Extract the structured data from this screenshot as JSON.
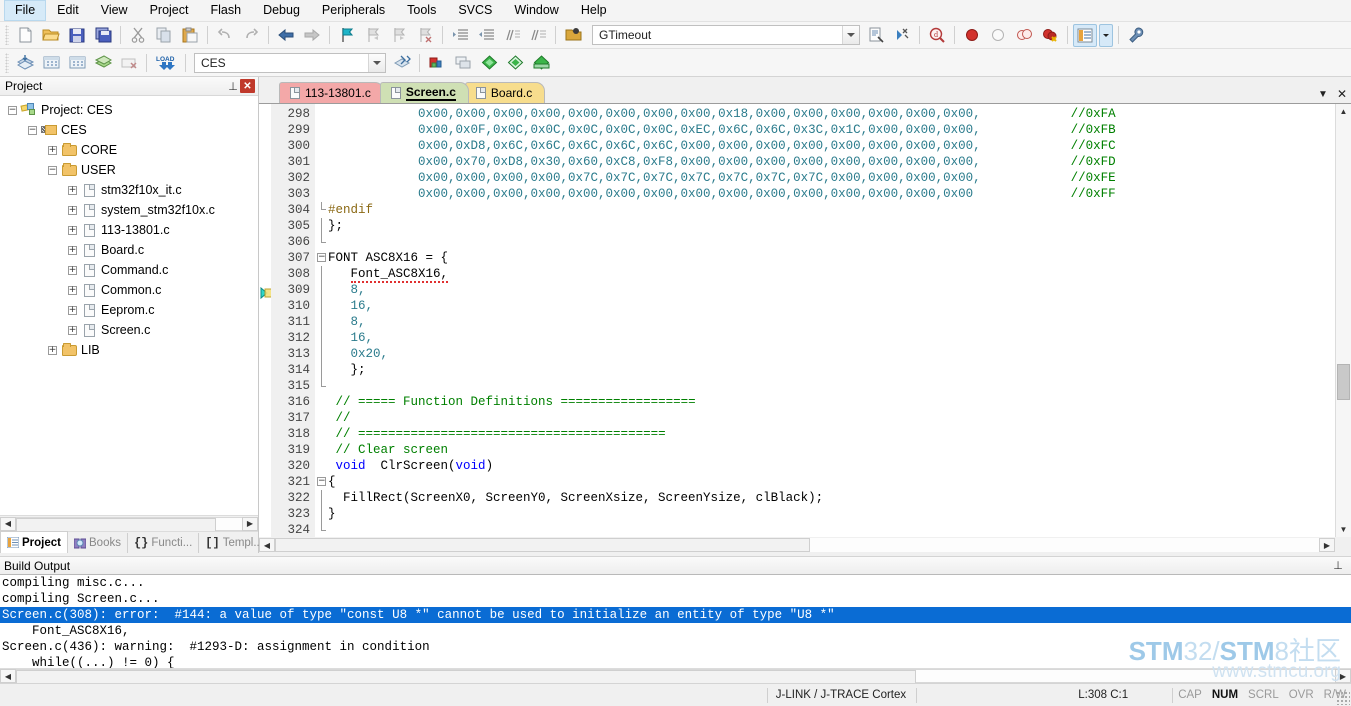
{
  "app": {
    "title": "uVision"
  },
  "menubar": {
    "items": [
      "File",
      "Edit",
      "View",
      "Project",
      "Flash",
      "Debug",
      "Peripherals",
      "Tools",
      "SVCS",
      "Window",
      "Help"
    ]
  },
  "toolbar1": {
    "buttons": [
      {
        "name": "new-file-icon",
        "label": "New"
      },
      {
        "name": "open-file-icon",
        "label": "Open"
      },
      {
        "name": "save-icon",
        "label": "Save"
      },
      {
        "name": "save-all-icon",
        "label": "Save All"
      },
      {
        "name": "cut-icon",
        "label": "Cut"
      },
      {
        "name": "copy-icon",
        "label": "Copy"
      },
      {
        "name": "paste-icon",
        "label": "Paste"
      },
      {
        "name": "undo-icon",
        "label": "Undo"
      },
      {
        "name": "redo-icon",
        "label": "Redo"
      },
      {
        "name": "navigate-back-icon",
        "label": "Back"
      },
      {
        "name": "navigate-forward-icon",
        "label": "Forward"
      },
      {
        "name": "bookmark-toggle-icon",
        "label": "Insert/Remove Bookmark"
      },
      {
        "name": "bookmark-prev-icon",
        "label": "Previous Bookmark"
      },
      {
        "name": "bookmark-next-icon",
        "label": "Next Bookmark"
      },
      {
        "name": "bookmark-clear-icon",
        "label": "Clear All Bookmarks"
      },
      {
        "name": "indent-icon",
        "label": "Indent Selected Text"
      },
      {
        "name": "outdent-icon",
        "label": "Outdent Selected Text"
      },
      {
        "name": "comment-icon",
        "label": "Comment Selection"
      },
      {
        "name": "uncomment-icon",
        "label": "Uncomment Selection"
      }
    ],
    "project_combo_value": "GTimeout",
    "project_combo_placeholder": "",
    "right_buttons": [
      {
        "name": "find-in-files-icon",
        "label": "Find in Files"
      },
      {
        "name": "incremental-find-icon",
        "label": "Incremental Find"
      },
      {
        "name": "find-all-icon",
        "label": "Find"
      },
      {
        "name": "breakpoint-icon",
        "label": "Insert/Remove Breakpoint"
      },
      {
        "name": "breakpoint-disable-icon",
        "label": "Enable/Disable Breakpoint"
      },
      {
        "name": "breakpoint-disable-all-icon",
        "label": "Disable All Breakpoints"
      },
      {
        "name": "breakpoint-kill-all-icon",
        "label": "Kill All Breakpoints"
      },
      {
        "name": "manage-windows-icon",
        "label": "Manage Components"
      },
      {
        "name": "configure-icon",
        "label": "Configuration Wizard"
      }
    ]
  },
  "toolbar2": {
    "buttons": [
      {
        "name": "translate-icon",
        "label": "Translate Current File"
      },
      {
        "name": "build-icon",
        "label": "Build"
      },
      {
        "name": "rebuild-icon",
        "label": "Rebuild"
      },
      {
        "name": "batch-build-icon",
        "label": "Batch Build"
      },
      {
        "name": "stop-build-icon",
        "label": "Stop Build"
      },
      {
        "name": "download-icon",
        "label": "Download"
      }
    ],
    "target_value": "CES",
    "right_buttons": [
      {
        "name": "target-options-icon",
        "label": "Options for Target"
      },
      {
        "name": "manage-project-items-icon",
        "label": "Manage Project Items"
      },
      {
        "name": "manage-run-time-icon",
        "label": "Manage Run-Time Environment"
      },
      {
        "name": "pack-installer-icon",
        "label": "Pack Installer"
      },
      {
        "name": "multi-project-icon",
        "label": "Multi-Project"
      },
      {
        "name": "svcs-icon",
        "label": "SVCS"
      }
    ]
  },
  "project_panel": {
    "title": "Project",
    "pin_label": "⊥",
    "close_label": "✕",
    "tree": [
      {
        "label": "Project: CES",
        "icon": "project-icon",
        "depth": 0,
        "expander": "−"
      },
      {
        "label": "CES",
        "icon": "target-icon",
        "depth": 1,
        "expander": "−"
      },
      {
        "label": "CORE",
        "icon": "folder-icon",
        "depth": 2,
        "expander": "+"
      },
      {
        "label": "USER",
        "icon": "folder-icon",
        "depth": 2,
        "expander": "−"
      },
      {
        "label": "stm32f10x_it.c",
        "icon": "file-icon",
        "depth": 3,
        "expander": "+"
      },
      {
        "label": "system_stm32f10x.c",
        "icon": "file-icon",
        "depth": 3,
        "expander": "+"
      },
      {
        "label": "113-13801.c",
        "icon": "file-icon",
        "depth": 3,
        "expander": "+"
      },
      {
        "label": "Board.c",
        "icon": "file-icon",
        "depth": 3,
        "expander": "+"
      },
      {
        "label": "Command.c",
        "icon": "file-icon",
        "depth": 3,
        "expander": "+"
      },
      {
        "label": "Common.c",
        "icon": "file-icon",
        "depth": 3,
        "expander": "+"
      },
      {
        "label": "Eeprom.c",
        "icon": "file-icon",
        "depth": 3,
        "expander": "+"
      },
      {
        "label": "Screen.c",
        "icon": "file-icon",
        "depth": 3,
        "expander": "+"
      },
      {
        "label": "LIB",
        "icon": "folder-icon",
        "depth": 2,
        "expander": "+"
      }
    ],
    "bottom_tabs": [
      {
        "label": "Project",
        "icon": "project-tab-icon",
        "active": true
      },
      {
        "label": "Books",
        "icon": "books-tab-icon",
        "active": false
      },
      {
        "label": "Functi...",
        "icon": "functions-tab-icon",
        "active": false
      },
      {
        "label": "Templ...",
        "icon": "templates-tab-icon",
        "active": false
      }
    ]
  },
  "editor": {
    "tabs": [
      {
        "label": "113-13801.c",
        "active": false,
        "color": "#f3a8a8"
      },
      {
        "label": "Screen.c",
        "active": true,
        "color": "#cfe0b4"
      },
      {
        "label": "Board.c",
        "active": false,
        "color": "#f7dd8d"
      }
    ],
    "first_line_number": 298,
    "lines": [
      {
        "n": 298,
        "fold": "",
        "segs": [
          {
            "t": "            ",
            "c": "plain"
          },
          {
            "t": "0x00,0x00,0x00,0x00,0x00,0x00,0x00,0x00,0x18,0x00,0x00,0x00,0x00,0x00,0x00,",
            "c": "num"
          },
          {
            "t": "            ",
            "c": "plain"
          },
          {
            "t": "//0xFA",
            "c": "cmt"
          }
        ]
      },
      {
        "n": 299,
        "fold": "",
        "segs": [
          {
            "t": "            ",
            "c": "plain"
          },
          {
            "t": "0x00,0x0F,0x0C,0x0C,0x0C,0x0C,0x0C,0xEC,0x6C,0x6C,0x3C,0x1C,0x00,0x00,0x00,",
            "c": "num"
          },
          {
            "t": "            ",
            "c": "plain"
          },
          {
            "t": "//0xFB",
            "c": "cmt"
          }
        ]
      },
      {
        "n": 300,
        "fold": "",
        "segs": [
          {
            "t": "            ",
            "c": "plain"
          },
          {
            "t": "0x00,0xD8,0x6C,0x6C,0x6C,0x6C,0x6C,0x00,0x00,0x00,0x00,0x00,0x00,0x00,0x00,",
            "c": "num"
          },
          {
            "t": "            ",
            "c": "plain"
          },
          {
            "t": "//0xFC",
            "c": "cmt"
          }
        ]
      },
      {
        "n": 301,
        "fold": "",
        "segs": [
          {
            "t": "            ",
            "c": "plain"
          },
          {
            "t": "0x00,0x70,0xD8,0x30,0x60,0xC8,0xF8,0x00,0x00,0x00,0x00,0x00,0x00,0x00,0x00,",
            "c": "num"
          },
          {
            "t": "            ",
            "c": "plain"
          },
          {
            "t": "//0xFD",
            "c": "cmt"
          }
        ]
      },
      {
        "n": 302,
        "fold": "",
        "segs": [
          {
            "t": "            ",
            "c": "plain"
          },
          {
            "t": "0x00,0x00,0x00,0x00,0x7C,0x7C,0x7C,0x7C,0x7C,0x7C,0x7C,0x00,0x00,0x00,0x00,",
            "c": "num"
          },
          {
            "t": "            ",
            "c": "plain"
          },
          {
            "t": "//0xFE",
            "c": "cmt"
          }
        ]
      },
      {
        "n": 303,
        "fold": "",
        "segs": [
          {
            "t": "            ",
            "c": "plain"
          },
          {
            "t": "0x00,0x00,0x00,0x00,0x00,0x00,0x00,0x00,0x00,0x00,0x00,0x00,0x00,0x00,0x00",
            "c": "num"
          },
          {
            "t": "             ",
            "c": "plain"
          },
          {
            "t": "//0xFF",
            "c": "cmt"
          }
        ]
      },
      {
        "n": 304,
        "fold": "endcap",
        "segs": [
          {
            "t": "#endif",
            "c": "pre"
          }
        ]
      },
      {
        "n": 305,
        "fold": "line",
        "segs": [
          {
            "t": "};",
            "c": "plain"
          }
        ]
      },
      {
        "n": 306,
        "fold": "endcap2",
        "segs": []
      },
      {
        "n": 307,
        "fold": "minus",
        "segs": [
          {
            "t": "FONT ASC8X16 = {",
            "c": "plain"
          }
        ]
      },
      {
        "n": 308,
        "fold": "line",
        "segs": [
          {
            "t": "   ",
            "c": "plain"
          },
          {
            "t": "Font_ASC8X16,",
            "c": "plain",
            "squig": true
          }
        ]
      },
      {
        "n": 309,
        "fold": "line",
        "segs": [
          {
            "t": "   ",
            "c": "plain"
          },
          {
            "t": "8,",
            "c": "num"
          }
        ]
      },
      {
        "n": 310,
        "fold": "line",
        "segs": [
          {
            "t": "   ",
            "c": "plain"
          },
          {
            "t": "16,",
            "c": "num"
          }
        ]
      },
      {
        "n": 311,
        "fold": "line",
        "segs": [
          {
            "t": "   ",
            "c": "plain"
          },
          {
            "t": "8,",
            "c": "num"
          }
        ]
      },
      {
        "n": 312,
        "fold": "line",
        "segs": [
          {
            "t": "   ",
            "c": "plain"
          },
          {
            "t": "16,",
            "c": "num"
          }
        ]
      },
      {
        "n": 313,
        "fold": "line",
        "segs": [
          {
            "t": "   ",
            "c": "plain"
          },
          {
            "t": "0x20,",
            "c": "num"
          }
        ]
      },
      {
        "n": 314,
        "fold": "line",
        "segs": [
          {
            "t": "   ",
            "c": "plain"
          },
          {
            "t": "};",
            "c": "plain"
          }
        ]
      },
      {
        "n": 315,
        "fold": "endcap2",
        "segs": []
      },
      {
        "n": 316,
        "fold": "",
        "segs": [
          {
            "t": " ",
            "c": "plain"
          },
          {
            "t": "// ===== Function Definitions ==================",
            "c": "cmt"
          }
        ]
      },
      {
        "n": 317,
        "fold": "",
        "segs": [
          {
            "t": " ",
            "c": "plain"
          },
          {
            "t": "//",
            "c": "cmt"
          }
        ]
      },
      {
        "n": 318,
        "fold": "",
        "segs": [
          {
            "t": " ",
            "c": "plain"
          },
          {
            "t": "// =========================================",
            "c": "cmt"
          }
        ]
      },
      {
        "n": 319,
        "fold": "",
        "segs": [
          {
            "t": " ",
            "c": "plain"
          },
          {
            "t": "// Clear screen",
            "c": "cmt"
          }
        ]
      },
      {
        "n": 320,
        "fold": "",
        "segs": [
          {
            "t": " ",
            "c": "plain"
          },
          {
            "t": "void",
            "c": "kw"
          },
          {
            "t": "  ClrScreen(",
            "c": "plain"
          },
          {
            "t": "void",
            "c": "kw"
          },
          {
            "t": ")",
            "c": "plain"
          }
        ]
      },
      {
        "n": 321,
        "fold": "minus",
        "segs": [
          {
            "t": "{",
            "c": "plain"
          }
        ]
      },
      {
        "n": 322,
        "fold": "line",
        "segs": [
          {
            "t": "  FillRect(ScreenX0, ScreenY0, ScreenXsize, ScreenYsize, clBlack);",
            "c": "plain"
          }
        ]
      },
      {
        "n": 323,
        "fold": "line",
        "segs": [
          {
            "t": "}",
            "c": "plain"
          }
        ]
      },
      {
        "n": 324,
        "fold": "endcap2",
        "segs": []
      }
    ]
  },
  "build_output": {
    "title": "Build Output",
    "lines": [
      {
        "text": "compiling misc.c...",
        "selected": false
      },
      {
        "text": "compiling Screen.c...",
        "selected": false
      },
      {
        "text": "Screen.c(308): error:  #144: a value of type \"const U8 *\" cannot be used to initialize an entity of type \"U8 *\"",
        "selected": true
      },
      {
        "text": "    Font_ASC8X16,",
        "selected": false
      },
      {
        "text": "Screen.c(436): warning:  #1293-D: assignment in condition",
        "selected": false
      },
      {
        "text": "    while((...) != 0) {",
        "selected": false
      }
    ]
  },
  "status_bar": {
    "debugger": "J-LINK / J-TRACE Cortex",
    "cursor": "L:308 C:1",
    "indicators": [
      {
        "label": "CAP",
        "on": false
      },
      {
        "label": "NUM",
        "on": true
      },
      {
        "label": "SCRL",
        "on": false
      },
      {
        "label": "OVR",
        "on": false
      },
      {
        "label": "R/W",
        "on": false
      }
    ]
  },
  "watermark": {
    "line1_a": "STM",
    "line1_b": "32/",
    "line1_c": "STM",
    "line1_d": "8社区",
    "line2": "www.stmcu.org"
  },
  "colors": {
    "selection_blue": "#0a6cd4",
    "comment_green": "#008000",
    "keyword_blue": "#0000ff",
    "number_teal": "#2a7b8c",
    "preproc_olive": "#8b6914",
    "tab_red": "#f3a8a8",
    "tab_green": "#cfe0b4",
    "tab_yellow": "#f7dd8d"
  }
}
